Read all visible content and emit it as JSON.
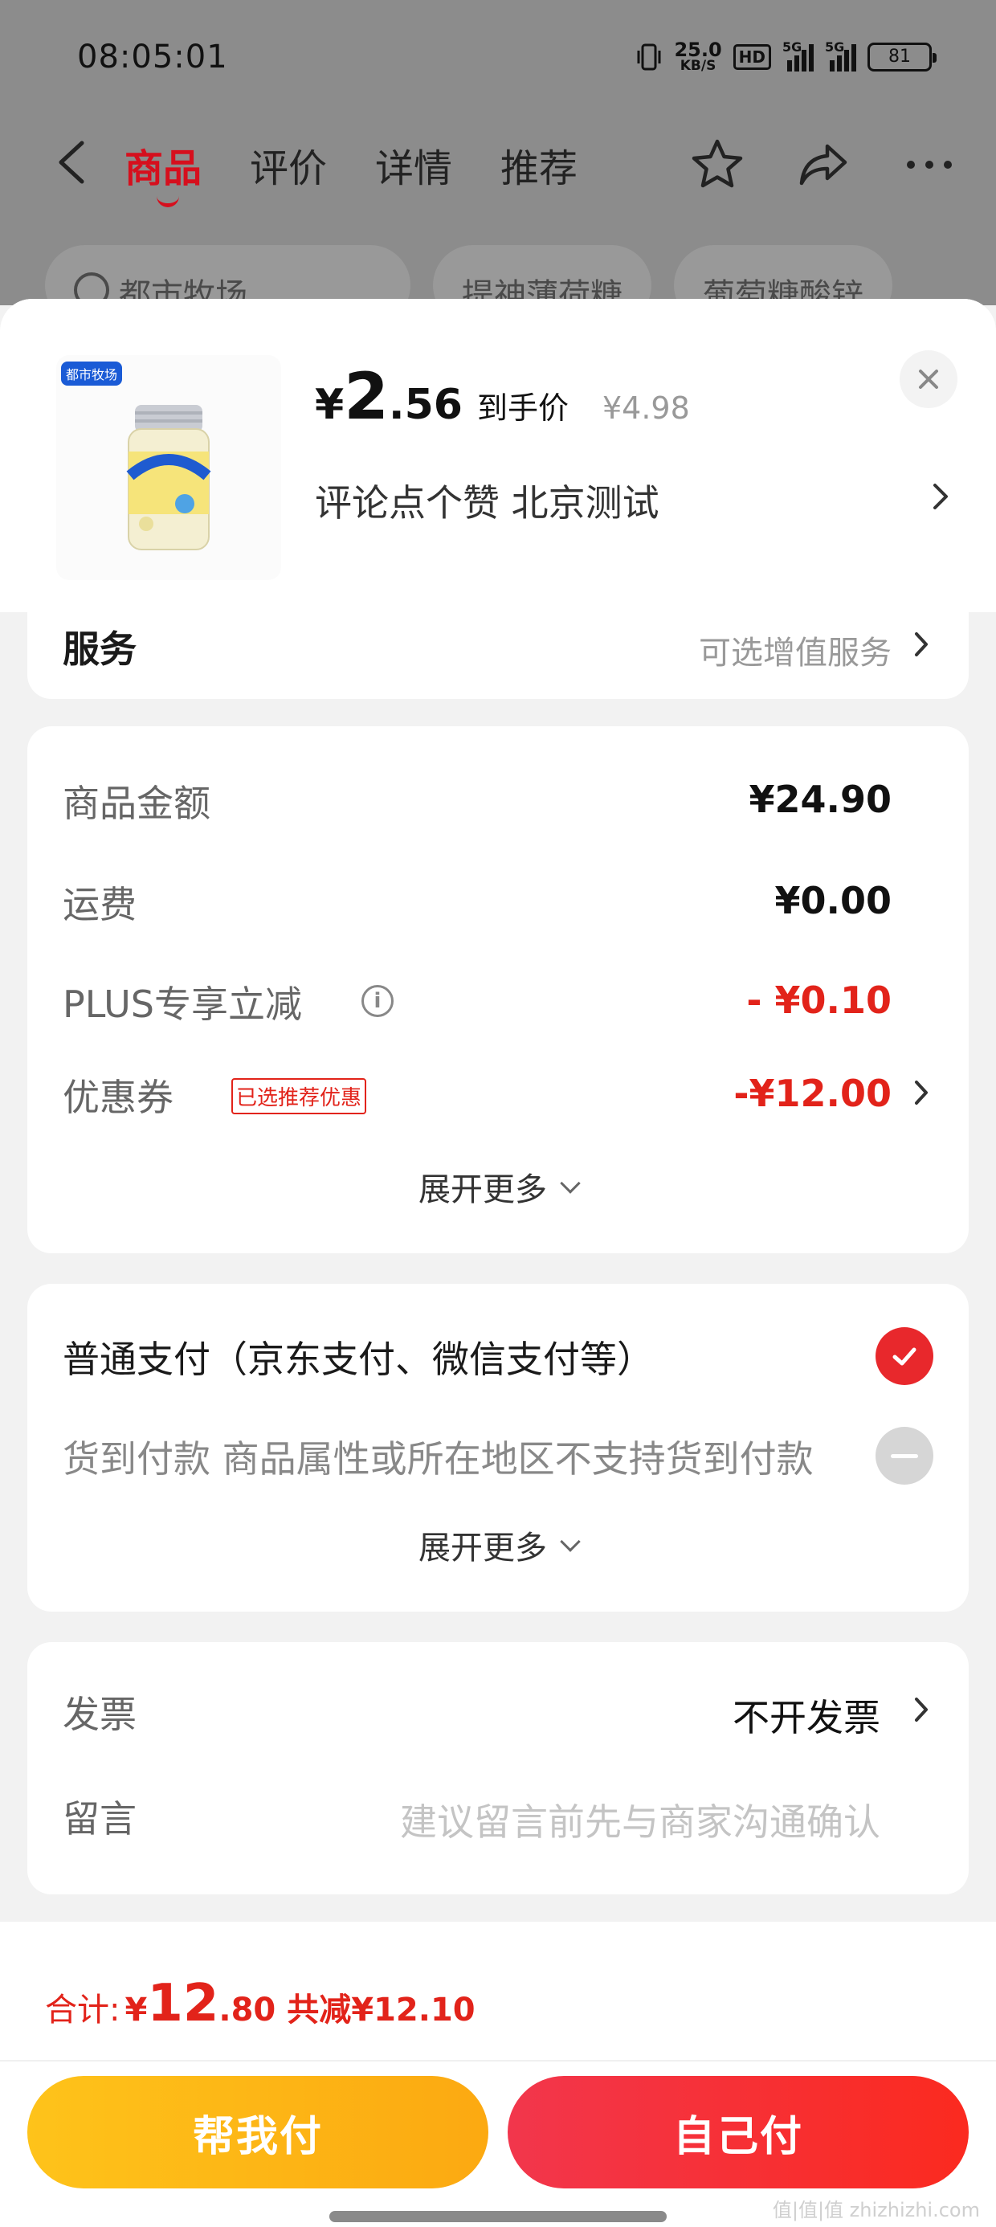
{
  "status_bar": {
    "time": "08:05:01",
    "net_speed_value": "25.0",
    "net_speed_unit": "KB/S",
    "hd_label": "HD",
    "sim1_tag": "5G",
    "sim2_tag": "5G",
    "battery": "81"
  },
  "nav": {
    "tabs": [
      "商品",
      "评价",
      "详情",
      "推荐"
    ],
    "active_tab": "商品"
  },
  "background_chips": {
    "search_placeholder": "都市牧场",
    "chip1": "提神薄荷糖",
    "chip2": "葡萄糖酸锌"
  },
  "product": {
    "brand_tag": "都市牧场",
    "price_symbol": "¥",
    "price_int": "2",
    "price_dec": ".56",
    "price_label": "到手价",
    "original_price": "¥4.98",
    "spec": "评论点个赞  北京测试"
  },
  "service": {
    "title": "服务",
    "hint": "可选增值服务"
  },
  "amounts": {
    "goods_label": "商品金额",
    "goods_value": "¥24.90",
    "freight_label": "运费",
    "freight_value": "¥0.00",
    "plus_label": "PLUS专享立减",
    "plus_value": "- ¥0.10",
    "coupon_label": "优惠券",
    "coupon_tag": "已选推荐优惠",
    "coupon_value": "-¥12.00",
    "expand_label": "展开更多"
  },
  "payment": {
    "normal_label": "普通支付（京东支付、微信支付等）",
    "cod_label": "货到付款 商品属性或所在地区不支持货到付款",
    "expand_label": "展开更多"
  },
  "invoice": {
    "invoice_label": "发票",
    "invoice_value": "不开发票",
    "message_label": "留言",
    "message_placeholder": "建议留言前先与商家沟通确认"
  },
  "footer": {
    "total_label": "合计:",
    "total_symbol": "¥",
    "total_int": "12",
    "total_dec": ".80",
    "saving": "共减¥12.10",
    "help_pay_label": "帮我付",
    "self_pay_label": "自己付"
  },
  "watermark": "值|值|值 zhizhizhi.com",
  "colors": {
    "accent_red": "#e2231a",
    "help_button": "#fdb615",
    "self_button": "#f5302f"
  }
}
